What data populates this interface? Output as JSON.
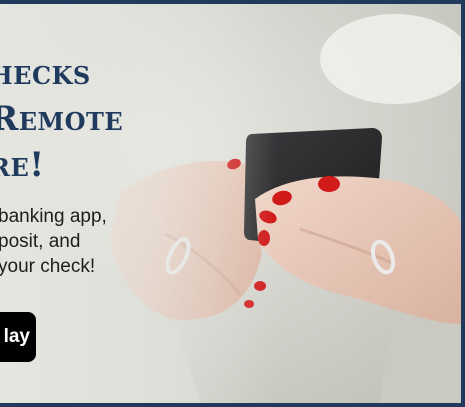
{
  "banner": {
    "headline_lines": [
      "hecks",
      "Remote",
      "re!"
    ],
    "body_lines": [
      "banking app,",
      "posit, and",
      "your check!"
    ],
    "store_badge_label": "lay"
  },
  "colors": {
    "headline": "#1f3a5c",
    "frame_border": "#1f3a5c",
    "phone": "#2b2b2d",
    "nail_polish": "#d11a1a",
    "badge_background": "#000000"
  }
}
